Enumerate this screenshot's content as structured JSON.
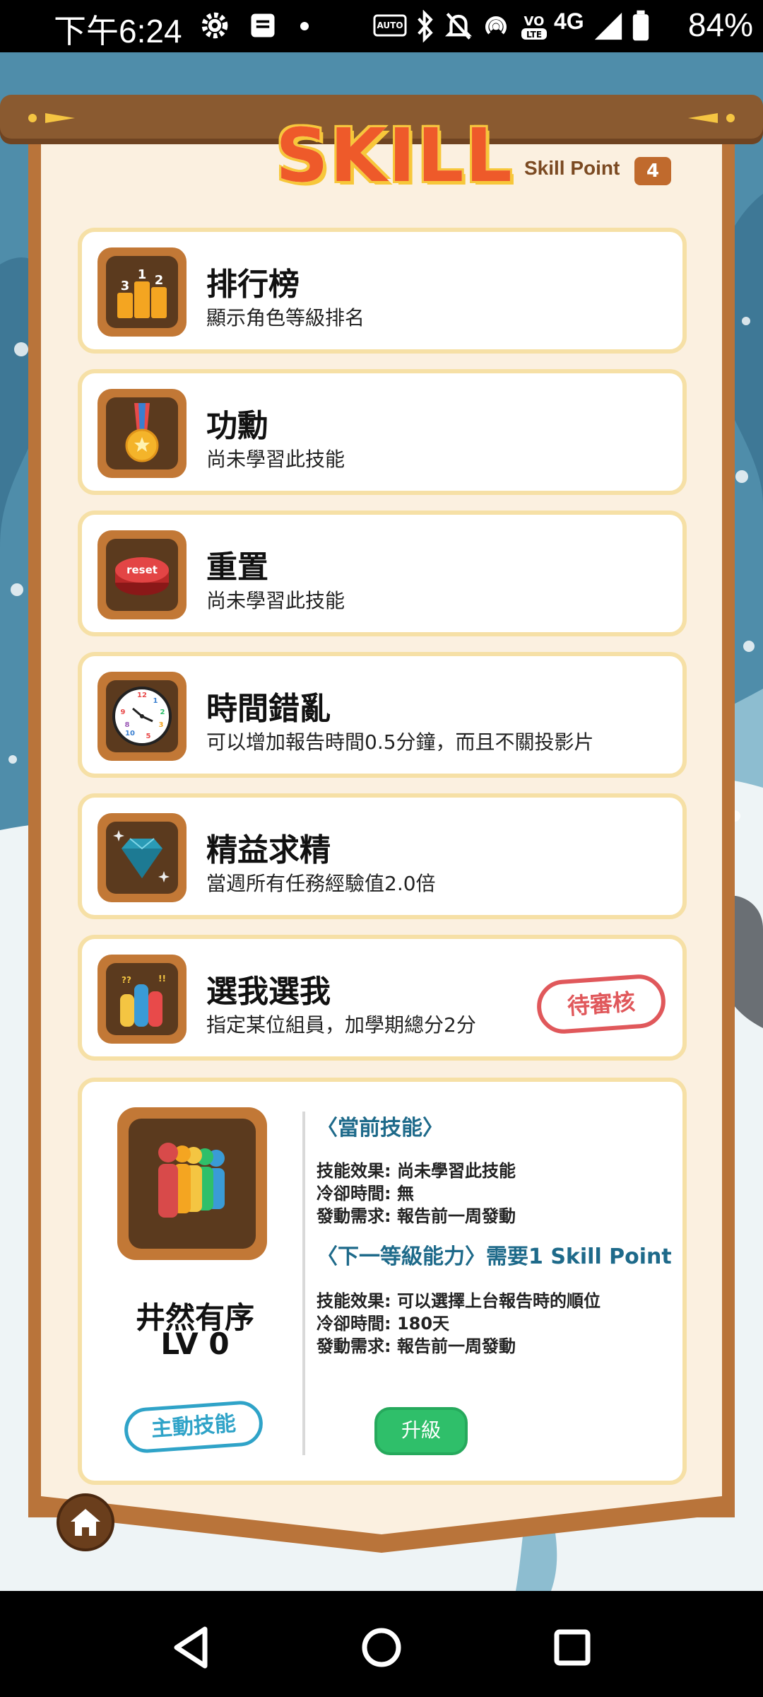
{
  "status_bar": {
    "time": "下午6:24",
    "battery": "84%",
    "network": "4G"
  },
  "header": {
    "title": "SKILL",
    "skill_point_label": "Skill Point",
    "skill_point_value": "4"
  },
  "skills": [
    {
      "name": "排行榜",
      "desc": "顯示角色等級排名",
      "icon": "podium-icon"
    },
    {
      "name": "功勳",
      "desc": "尚未學習此技能",
      "icon": "medal-icon"
    },
    {
      "name": "重置",
      "desc": "尚未學習此技能",
      "icon": "reset-button-icon"
    },
    {
      "name": "時間錯亂",
      "desc": "可以增加報告時間0.5分鐘，而且不關投影片",
      "icon": "clock-icon"
    },
    {
      "name": "精益求精",
      "desc": "當週所有任務經驗值2.0倍",
      "icon": "diamond-icon"
    },
    {
      "name": "選我選我",
      "desc": "指定某位組員，加學期總分2分",
      "icon": "raised-hands-icon",
      "status": "待審核"
    }
  ],
  "detail": {
    "icon": "people-queue-icon",
    "name": "井然有序",
    "level": "LV 0",
    "type_label": "主動技能",
    "current_heading": "〈當前技能〉",
    "current_effect": "技能效果: 尚未學習此技能",
    "current_cooldown": "冷卻時間: 無",
    "current_requirement": "發動需求: 報告前一周發動",
    "next_heading": "〈下一等級能力〉需要1 Skill Point",
    "next_effect": "技能效果: 可以選擇上台報告時的順位",
    "next_cooldown": "冷卻時間: 180天",
    "next_requirement": "發動需求: 報告前一周發動",
    "upgrade_label": "升級"
  },
  "nav": {
    "home": "home-icon"
  },
  "colors": {
    "banner_frame": "#b9743a",
    "banner_fill": "#fbf0e0",
    "card_border": "#f6e0a6",
    "accent_title": "#ee5a2a",
    "pending": "#e0585b",
    "active_skill": "#2fa3c8",
    "upgrade": "#2fbf6a"
  }
}
